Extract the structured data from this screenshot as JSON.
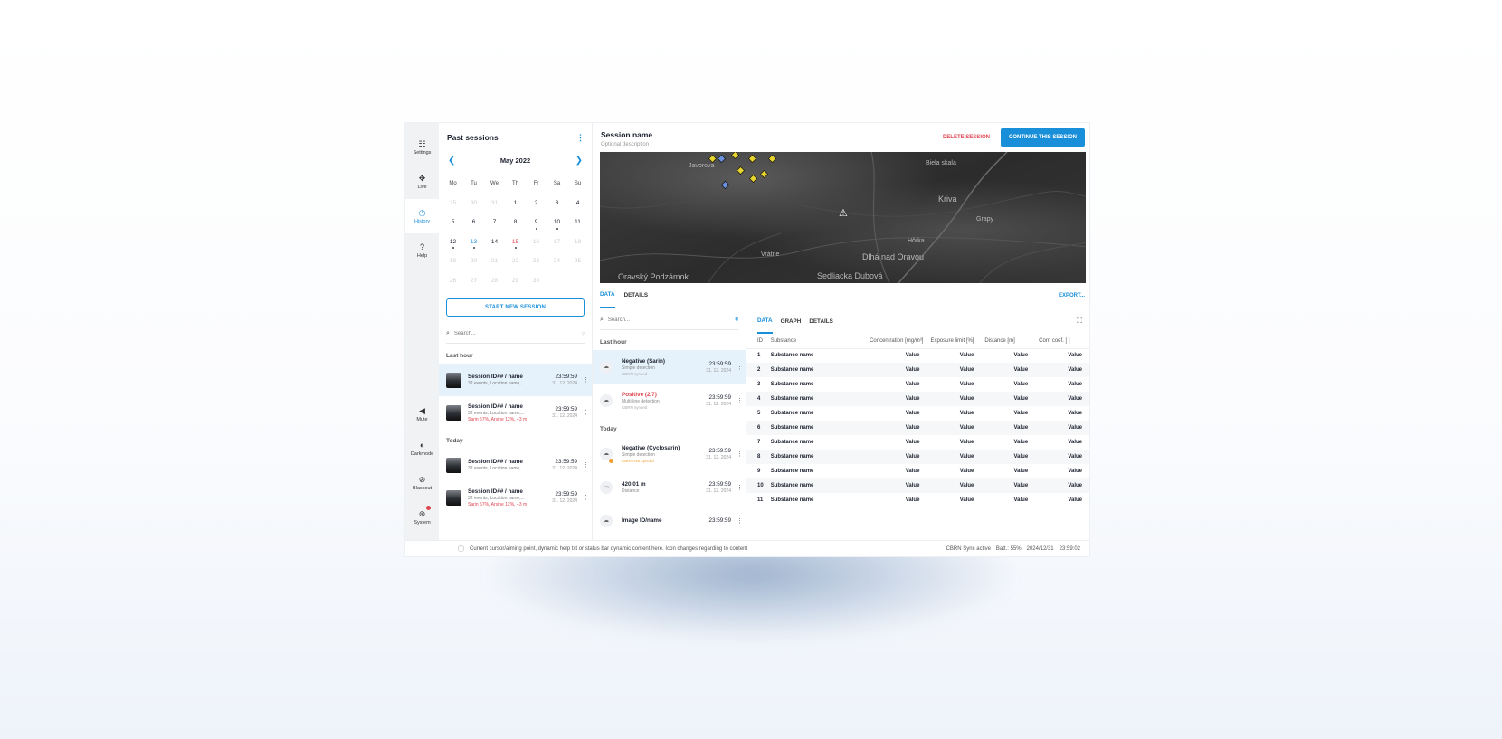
{
  "rail": {
    "settings": "Settings",
    "live": "Live",
    "history": "History",
    "help": "Help",
    "mute": "Mute",
    "darkmode": "Darkmode",
    "blackout": "Blackout",
    "system": "System"
  },
  "past": {
    "title": "Past sessions",
    "month": "May 2022",
    "weekdays": [
      "Mo",
      "Tu",
      "We",
      "Th",
      "Fr",
      "Sa",
      "Su"
    ],
    "days": [
      {
        "d": "25",
        "m": true
      },
      {
        "d": "30",
        "m": true
      },
      {
        "d": "31",
        "m": true
      },
      {
        "d": "1"
      },
      {
        "d": "2"
      },
      {
        "d": "3"
      },
      {
        "d": "4"
      },
      {
        "d": "5"
      },
      {
        "d": "6"
      },
      {
        "d": "7"
      },
      {
        "d": "8"
      },
      {
        "d": "9",
        "ev": true
      },
      {
        "d": "10",
        "ev": true
      },
      {
        "d": "11"
      },
      {
        "d": "12",
        "ev": true
      },
      {
        "d": "13",
        "sel": true,
        "ev": true
      },
      {
        "d": "14"
      },
      {
        "d": "15",
        "red": true,
        "ev": true
      },
      {
        "d": "16",
        "m": true
      },
      {
        "d": "17",
        "m": true
      },
      {
        "d": "18",
        "m": true
      },
      {
        "d": "19",
        "m": true
      },
      {
        "d": "20",
        "m": true
      },
      {
        "d": "21",
        "m": true
      },
      {
        "d": "22",
        "m": true
      },
      {
        "d": "23",
        "m": true
      },
      {
        "d": "24",
        "m": true
      },
      {
        "d": "25",
        "m": true
      },
      {
        "d": "26",
        "m": true
      },
      {
        "d": "27",
        "m": true
      },
      {
        "d": "28",
        "m": true
      },
      {
        "d": "29",
        "m": true
      },
      {
        "d": "30",
        "m": true
      },
      {
        "d": ""
      },
      {
        "d": ""
      }
    ],
    "start_label": "START NEW SESSION",
    "search_placeholder": "Search...",
    "section_last_hour": "Last hour",
    "section_today": "Today",
    "sessions": [
      {
        "name": "Session ID## / name",
        "sub": "32 events, Location name,...",
        "alert": "",
        "time": "23:59:59",
        "date": "31. 12. 2024"
      },
      {
        "name": "Session ID## / name",
        "sub": "32 events, Location name,...",
        "alert": "Sarin 57%, Arsine 12%, +3 m",
        "time": "23:59:59",
        "date": "31. 12. 2024"
      },
      {
        "name": "Session ID## / name",
        "sub": "32 events, Location name,...",
        "alert": "",
        "time": "23:59:59",
        "date": "31. 12. 2024"
      },
      {
        "name": "Session ID## / name",
        "sub": "32 events, Location name,...",
        "alert": "Sarin 57%, Arsine 12%, +3 m",
        "time": "23:59:59",
        "date": "31. 12. 2024"
      }
    ]
  },
  "session": {
    "title": "Session name",
    "desc": "Optional description",
    "delete_label": "DELETE SESSION",
    "continue_label": "CONTINUE THIS SESSION"
  },
  "map": {
    "labels": [
      "Javorová",
      "Biela skala",
      "Kriva",
      "Grapy",
      "Hôrka",
      "Vrátne",
      "Dlhá nad Oravou",
      "Oravský Podzámok",
      "Sedliacka Dubová"
    ]
  },
  "tabs": {
    "data": "DATA",
    "details": "DETAILS",
    "export": "EXPORT..."
  },
  "events": {
    "search_placeholder": "Search...",
    "section_last_hour": "Last hour",
    "section_today": "Today",
    "items": [
      {
        "name": "Negative (Sarin)",
        "sub": "Simple detection",
        "sync": "CBRN synced",
        "time": "23:59:59",
        "date": "31. 12. 2024"
      },
      {
        "name": "Positive (2/7)",
        "sub": "Multi-line detection",
        "sync": "CBRN synced",
        "time": "23:59:59",
        "date": "31. 12. 2024"
      },
      {
        "name": "Negative (Cyclosarin)",
        "sub": "Simple detection",
        "sync": "CBRN not synced",
        "time": "23:59:59",
        "date": "31. 12. 2024"
      },
      {
        "name": "420.01 m",
        "sub": "Distance",
        "sync": "",
        "time": "23:59:59",
        "date": "31. 12. 2024"
      },
      {
        "name": "Image ID/name",
        "sub": "",
        "sync": "",
        "time": "23:59:59",
        "date": ""
      }
    ]
  },
  "detail": {
    "tabs": [
      "DATA",
      "GRAPH",
      "DETAILS"
    ],
    "columns": [
      "ID",
      "Substance",
      "Concentration [mg/m³]",
      "Exposure limit [%]",
      "Distance [m]",
      "Corr. coef. [ ]"
    ],
    "rows": [
      [
        "1",
        "Substance name",
        "Value",
        "Value",
        "Value",
        "Value"
      ],
      [
        "2",
        "Substance name",
        "Value",
        "Value",
        "Value",
        "Value"
      ],
      [
        "3",
        "Substance name",
        "Value",
        "Value",
        "Value",
        "Value"
      ],
      [
        "4",
        "Substance name",
        "Value",
        "Value",
        "Value",
        "Value"
      ],
      [
        "5",
        "Substance name",
        "Value",
        "Value",
        "Value",
        "Value"
      ],
      [
        "6",
        "Substance name",
        "Value",
        "Value",
        "Value",
        "Value"
      ],
      [
        "7",
        "Substance name",
        "Value",
        "Value",
        "Value",
        "Value"
      ],
      [
        "8",
        "Substance name",
        "Value",
        "Value",
        "Value",
        "Value"
      ],
      [
        "9",
        "Substance name",
        "Value",
        "Value",
        "Value",
        "Value"
      ],
      [
        "10",
        "Substance name",
        "Value",
        "Value",
        "Value",
        "Value"
      ],
      [
        "11",
        "Substance name",
        "Value",
        "Value",
        "Value",
        "Value"
      ]
    ]
  },
  "status": {
    "help": "Current cursor/aiming point, dynamic help txt or status bar dynamic content here. Icon changes regarding to content",
    "sync": "CBRN Sync active",
    "battery": "Batt.: 55%",
    "date": "2024/12/31",
    "time": "23:59:02"
  }
}
